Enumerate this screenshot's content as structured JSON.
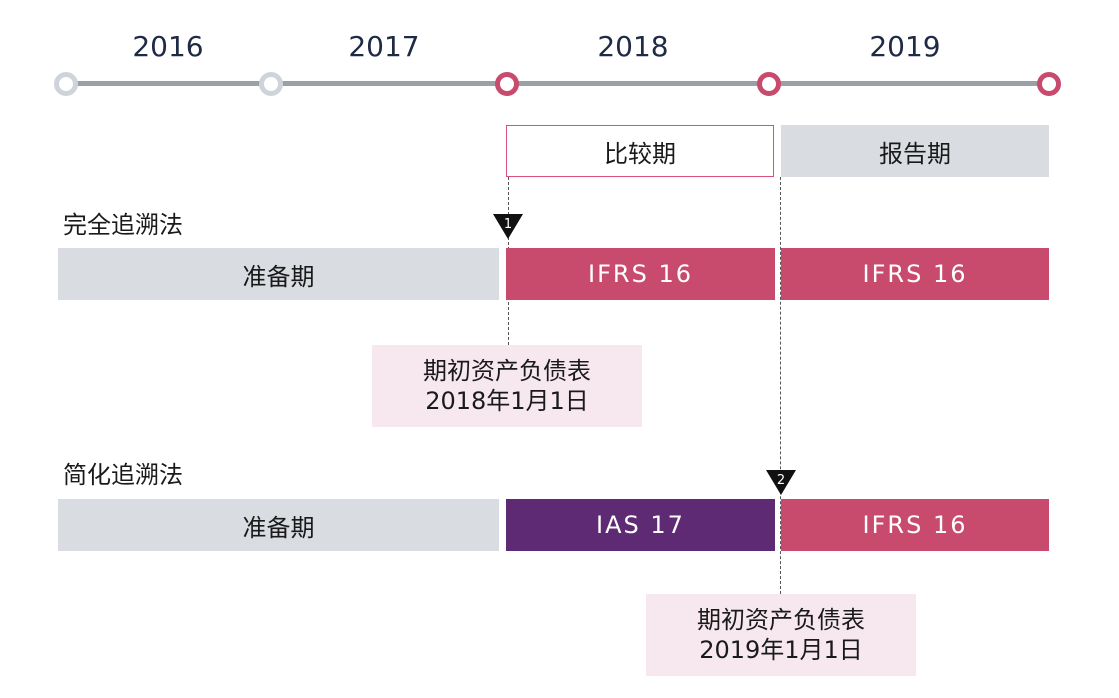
{
  "years": [
    "2016",
    "2017",
    "2018",
    "2019"
  ],
  "periods": {
    "comparative": "比较期",
    "reporting": "报告期"
  },
  "full": {
    "label": "完全追溯法",
    "marker": "1",
    "bars": {
      "prep": "准备期",
      "compare": "IFRS 16",
      "report": "IFRS 16"
    },
    "callout": {
      "line1": "期初资产负债表",
      "line2": "2018年1月1日"
    }
  },
  "simplified": {
    "label": "简化追溯法",
    "marker": "2",
    "bars": {
      "prep": "准备期",
      "compare": "IAS 17",
      "report": "IFRS 16"
    },
    "callout": {
      "line1": "期初资产负债表",
      "line2": "2019年1月1日"
    }
  },
  "colors": {
    "ifrs": "#c84b6e",
    "ias": "#5f2a74",
    "grey": "#d9dde2",
    "callout": "#f6e8ee"
  }
}
